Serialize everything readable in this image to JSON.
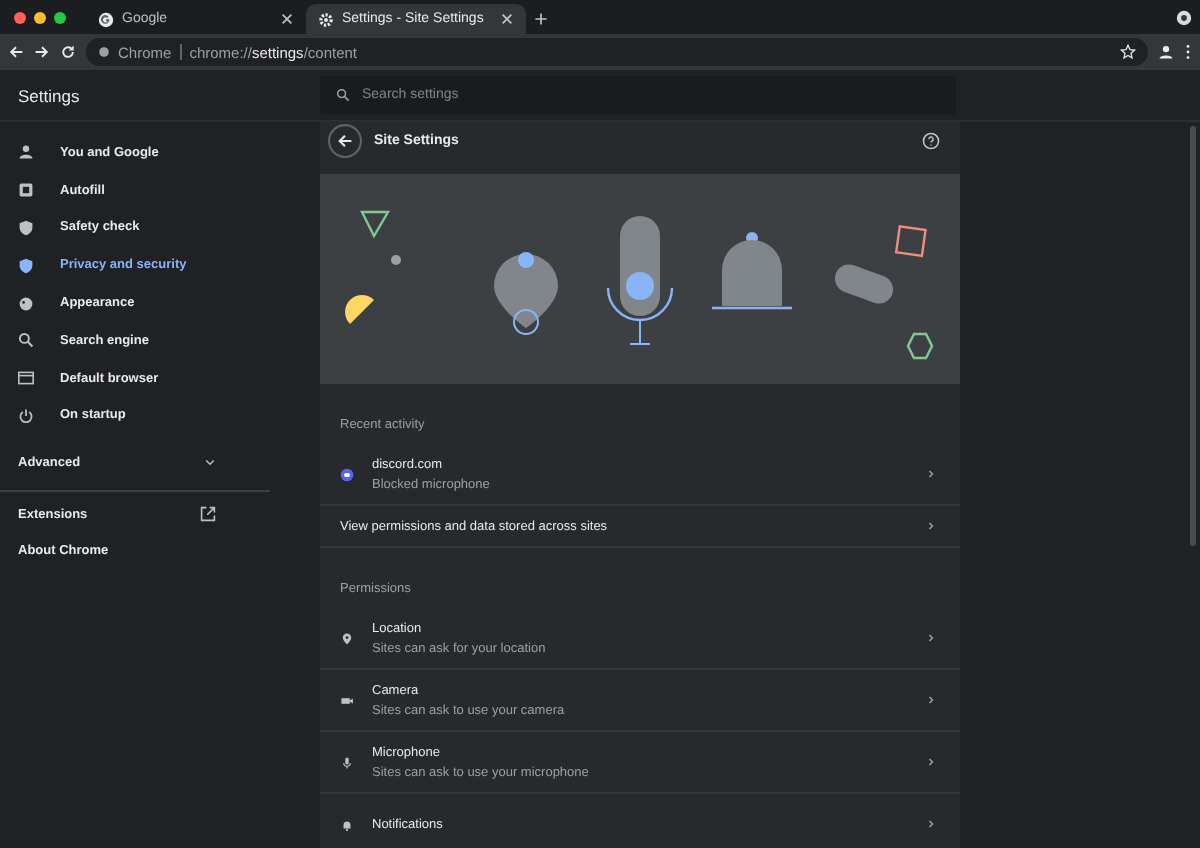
{
  "tabs": [
    {
      "title": "Google",
      "selected": false
    },
    {
      "title": "Settings - Site Settings",
      "selected": true
    }
  ],
  "toolbar": {
    "site_chip": "Chrome",
    "url": "chrome://**settings**/content"
  },
  "settings_header": {
    "title": "Settings",
    "search": {
      "placeholder": "Search settings"
    }
  },
  "sidebar": {
    "items": [
      {
        "label": "You and Google",
        "selected": false
      },
      {
        "label": "Autofill",
        "selected": false
      },
      {
        "label": "Safety check",
        "selected": false
      },
      {
        "label": "Privacy and security",
        "selected": true
      },
      {
        "label": "Appearance",
        "selected": false
      },
      {
        "label": "Search engine",
        "selected": false
      },
      {
        "label": "Default browser",
        "selected": false
      },
      {
        "label": "On startup",
        "selected": false
      }
    ],
    "advanced": {
      "label": "Advanced",
      "expanded": false
    },
    "links": [
      "Extensions",
      "About Chrome"
    ]
  },
  "page": {
    "title": "Site Settings",
    "sections": [
      {
        "heading": "Recent activity",
        "rows": [
          {
            "kind": "site",
            "title": "discord.com",
            "subtitle": "Blocked microphone"
          },
          {
            "kind": "link",
            "title": "View permissions and data stored across sites"
          }
        ]
      },
      {
        "heading": "Permissions",
        "rows": [
          {
            "kind": "permission",
            "title": "Location",
            "subtitle": "Sites can ask for your location"
          },
          {
            "kind": "permission",
            "title": "Camera",
            "subtitle": "Sites can ask to use your camera"
          },
          {
            "kind": "permission",
            "title": "Microphone",
            "subtitle": "Sites can ask to use your microphone"
          },
          {
            "kind": "permission",
            "title": "Notifications"
          }
        ]
      }
    ]
  }
}
